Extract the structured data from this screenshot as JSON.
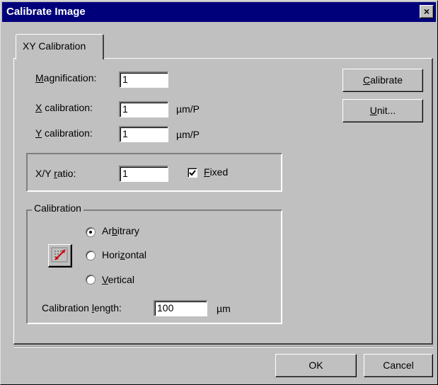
{
  "window": {
    "title": "Calibrate Image",
    "close_label": "×"
  },
  "tabs": [
    {
      "label": "XY Calibration"
    }
  ],
  "fields": {
    "magnification": {
      "label_pre": "",
      "label_access": "M",
      "label_post": "agnification:",
      "value": "1"
    },
    "x_calibration": {
      "label_pre": "",
      "label_access": "X",
      "label_post": " calibration:",
      "value": "1",
      "unit": "µm/P"
    },
    "y_calibration": {
      "label_pre": "",
      "label_access": "Y",
      "label_post": " calibration:",
      "value": "1",
      "unit": "µm/P"
    }
  },
  "buttons": {
    "calibrate": {
      "pre": "",
      "access": "C",
      "post": "alibrate"
    },
    "unit": {
      "pre": "",
      "access": "U",
      "post": "nit..."
    },
    "ok": "OK",
    "cancel": "Cancel"
  },
  "ratio": {
    "label_pre": "X/Y ",
    "label_access": "r",
    "label_post": "atio:",
    "value": "1",
    "fixed_access": "F",
    "fixed_post": "ixed",
    "fixed_checked": true
  },
  "calibration_group": {
    "title": "Calibration",
    "options": [
      {
        "pre": "Ar",
        "access": "b",
        "post": "itrary",
        "selected": true
      },
      {
        "pre": "Hori",
        "access": "z",
        "post": "ontal",
        "selected": false
      },
      {
        "pre": "",
        "access": "V",
        "post": "ertical",
        "selected": false
      }
    ],
    "length_pre": "Calibration ",
    "length_access": "l",
    "length_post": "ength:",
    "length_value": "100",
    "length_unit": "µm",
    "tool_icon": "calibration-line-icon"
  },
  "colors": {
    "titlebar": "#00007b",
    "face": "#c0c0c0",
    "accent_red": "#d00000"
  }
}
